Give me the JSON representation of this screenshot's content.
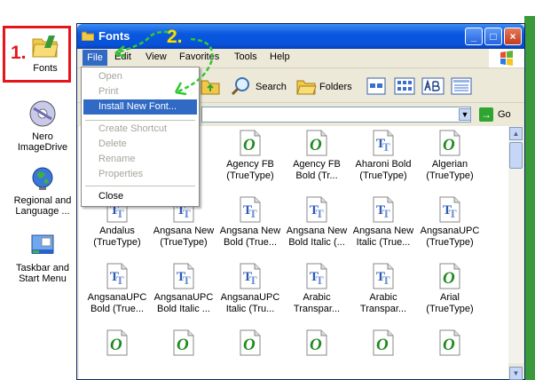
{
  "annotations": {
    "step1": "1.",
    "step2": "2."
  },
  "desktop": {
    "icons": [
      {
        "label1": "Fonts",
        "label2": ""
      },
      {
        "label1": "Nero",
        "label2": "ImageDrive"
      },
      {
        "label1": "Regional and",
        "label2": "Language ..."
      },
      {
        "label1": "Taskbar and",
        "label2": "Start Menu"
      }
    ]
  },
  "window": {
    "title": "Fonts",
    "controls": {
      "minimize": "_",
      "maximize": "□",
      "close": "×"
    },
    "menu": [
      "File",
      "Edit",
      "View",
      "Favorites",
      "Tools",
      "Help"
    ],
    "toolbar": {
      "search": "Search",
      "folders": "Folders"
    },
    "address": {
      "go": "Go"
    }
  },
  "file_menu": {
    "items": [
      {
        "label": "Open",
        "state": "disabled"
      },
      {
        "label": "Print",
        "state": "disabled"
      },
      {
        "label": "Install New Font...",
        "state": "highlighted"
      },
      {
        "label": "Create Shortcut",
        "state": "disabled"
      },
      {
        "label": "Delete",
        "state": "disabled"
      },
      {
        "label": "Rename",
        "state": "disabled"
      },
      {
        "label": "Properties",
        "state": "disabled"
      },
      {
        "label": "Close",
        "state": "normal"
      }
    ]
  },
  "fonts": [
    {
      "line1": "",
      "line2": "...",
      "icon": "truetype-icon"
    },
    {
      "line1": "",
      "line2": "...)",
      "icon": "truetype-icon"
    },
    {
      "line1": "Agency FB",
      "line2": "(TrueType)",
      "icon": "opentype-icon"
    },
    {
      "line1": "Agency FB",
      "line2": "Bold (Tr...",
      "icon": "opentype-icon"
    },
    {
      "line1": "Aharoni Bold",
      "line2": "(TrueType)",
      "icon": "truetype-icon"
    },
    {
      "line1": "Algerian",
      "line2": "(TrueType)",
      "icon": "opentype-icon"
    },
    {
      "line1": "Andalus",
      "line2": "(TrueType)",
      "icon": "truetype-icon"
    },
    {
      "line1": "Angsana New",
      "line2": "(TrueType)",
      "icon": "truetype-icon"
    },
    {
      "line1": "Angsana New",
      "line2": "Bold (True...",
      "icon": "truetype-icon"
    },
    {
      "line1": "Angsana New",
      "line2": "Bold Italic (...",
      "icon": "truetype-icon"
    },
    {
      "line1": "Angsana New",
      "line2": "Italic (True...",
      "icon": "truetype-icon"
    },
    {
      "line1": "AngsanaUPC",
      "line2": "(TrueType)",
      "icon": "truetype-icon"
    },
    {
      "line1": "AngsanaUPC",
      "line2": "Bold (True...",
      "icon": "truetype-icon"
    },
    {
      "line1": "AngsanaUPC",
      "line2": "Bold Italic ...",
      "icon": "truetype-icon"
    },
    {
      "line1": "AngsanaUPC",
      "line2": "Italic (Tru...",
      "icon": "truetype-icon"
    },
    {
      "line1": "Arabic",
      "line2": "Transpar...",
      "icon": "truetype-icon"
    },
    {
      "line1": "Arabic",
      "line2": "Transpar...",
      "icon": "truetype-icon"
    },
    {
      "line1": "Arial",
      "line2": "(TrueType)",
      "icon": "opentype-icon"
    },
    {
      "line1": "",
      "line2": "",
      "icon": "opentype-icon"
    },
    {
      "line1": "",
      "line2": "",
      "icon": "opentype-icon"
    },
    {
      "line1": "",
      "line2": "",
      "icon": "opentype-icon"
    },
    {
      "line1": "",
      "line2": "",
      "icon": "opentype-icon"
    },
    {
      "line1": "",
      "line2": "",
      "icon": "opentype-icon"
    },
    {
      "line1": "",
      "line2": "",
      "icon": "opentype-icon"
    }
  ],
  "colors": {
    "annotation_red": "#e4161c",
    "annotation_yellow": "#f5e300",
    "arrow_green": "#32c832",
    "highlight": "#316ac5"
  }
}
